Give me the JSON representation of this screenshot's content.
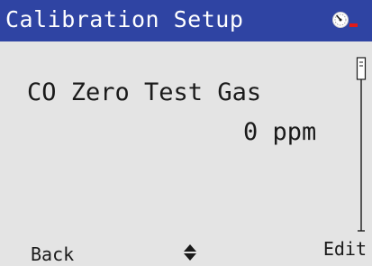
{
  "header": {
    "title": "Calibration Setup",
    "status_icon": "dial-gauge-with-red-alert-dash-icon",
    "colors": {
      "background": "#2f44a3",
      "text": "#ffffff",
      "alert": "#e11a1a"
    }
  },
  "main": {
    "parameter_label": "CO Zero Test Gas",
    "parameter_value": "0 ppm",
    "scrollbar": {
      "position": 0
    },
    "background": "#e4e4e4"
  },
  "softkeys": {
    "left_label": "Back",
    "center_icon": "up-down-arrows-icon",
    "right_label": "Edit"
  }
}
